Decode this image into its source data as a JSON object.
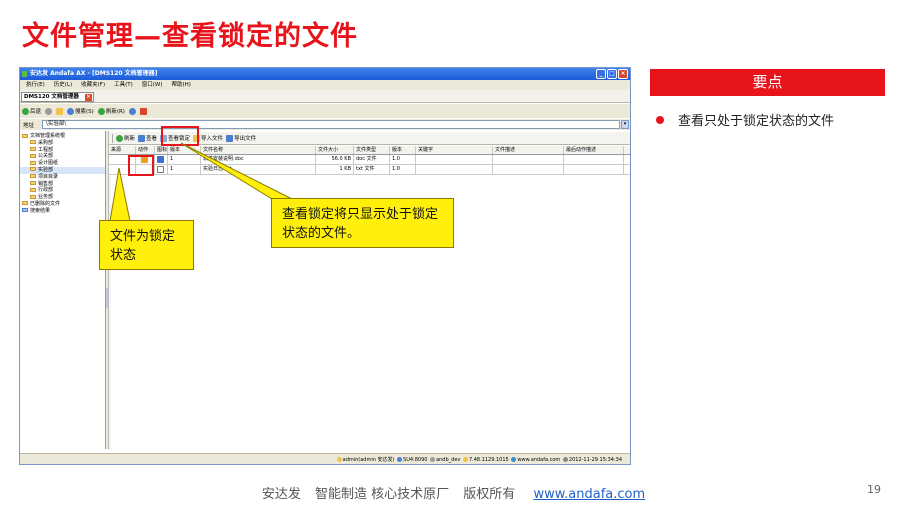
{
  "slide": {
    "title": "文件管理—查看锁定的文件",
    "page_number": "19"
  },
  "window": {
    "title": "安达发 Andafa AX - [DMS120 文档管理器]",
    "menu": [
      "执行(E)",
      "历史(L)",
      "收藏夹(F)",
      "工具(T)",
      "窗口(W)",
      "帮助(H)"
    ],
    "doc_tab": "DMS120 文档管理器",
    "nav": {
      "back": "后退",
      "search": "搜索(S)",
      "refresh": "刷新(R)"
    },
    "address": {
      "label": "地址",
      "value": "\\实验部\\"
    }
  },
  "tree": {
    "items": [
      {
        "label": "文档管理系统根",
        "depth": 0
      },
      {
        "label": "采购部",
        "depth": 1
      },
      {
        "label": "工程部",
        "depth": 1
      },
      {
        "label": "公关部",
        "depth": 1
      },
      {
        "label": "设计图纸",
        "depth": 1
      },
      {
        "label": "实验部",
        "depth": 1
      },
      {
        "label": "项目目录",
        "depth": 1
      },
      {
        "label": "销售部",
        "depth": 1
      },
      {
        "label": "行政部",
        "depth": 1
      },
      {
        "label": "业务部",
        "depth": 1
      },
      {
        "label": "已删除的文件",
        "depth": 0
      },
      {
        "label": "搜索结果",
        "depth": 0
      }
    ]
  },
  "toolbar": {
    "refresh": "刷新",
    "view": "查看",
    "view_locked": "查看锁定",
    "import": "导入文件",
    "export": "导出文件"
  },
  "grid": {
    "columns": [
      "来源",
      "动作",
      "图标",
      "版本",
      "文件名称",
      "文件大小",
      "文件类型",
      "版本",
      "关键字",
      "文件描述",
      "最后动作描述"
    ],
    "rows": [
      {
        "source": "",
        "action_icon": "lock-icon",
        "icon": "doc-icon",
        "ver": "1",
        "name": "软件安装说明.doc",
        "size": "56.0 KB",
        "type": "doc 文件",
        "version": "1.0",
        "keywords": "",
        "desc": "",
        "last_action": ""
      },
      {
        "source": "",
        "action_icon": "",
        "icon": "txt-icon",
        "ver": "1",
        "name": "实验日志.txt",
        "size": "1 KB",
        "type": "txt 文件",
        "version": "1.0",
        "keywords": "",
        "desc": "",
        "last_action": ""
      }
    ]
  },
  "statusbar": {
    "user": "admin(admin 安达发)",
    "server": "SU4:8090",
    "db": "andb_dev",
    "version": "7.48.1129.1015",
    "site": "www.andafa.com",
    "time": "2012-11-29 15:34:34"
  },
  "callouts": {
    "locked_status": "文件为锁定状态",
    "view_locked_note": "查看锁定将只显示处于锁定状态的文件。"
  },
  "key_points": {
    "header": "要点",
    "items": [
      "查看只处于锁定状态的文件"
    ]
  },
  "footer": {
    "company": "安达发",
    "slogan": "智能制造 核心技术原厂",
    "rights": "版权所有",
    "url": "www.andafa.com"
  },
  "colors": {
    "accent": "#e8141b",
    "callout": "#ffef0a",
    "link": "#2262c7"
  }
}
